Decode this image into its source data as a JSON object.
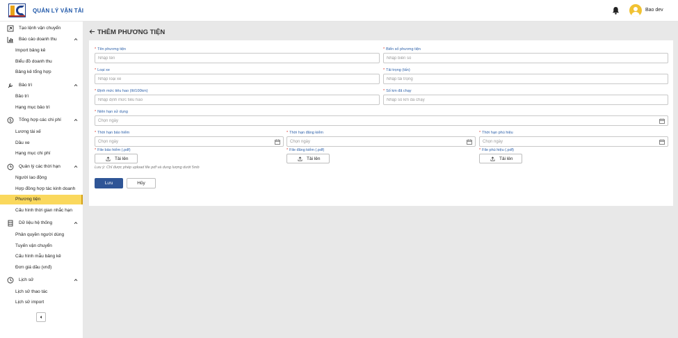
{
  "app": {
    "title": "QUẢN LÝ VẬN TẢI",
    "username": "Bao dev"
  },
  "icons": {
    "logo": "company-logo",
    "bell": "bell-icon",
    "avatar": "user-avatar-icon"
  },
  "colors": {
    "primary": "#2f5596",
    "active_menu": "#fad85d",
    "label_blue": "#2b5fa8",
    "required": "#d93025"
  },
  "sidebar": [
    {
      "type": "parent",
      "label": "Tạo lệnh vận chuyển",
      "icon": "external-link-icon"
    },
    {
      "type": "parent",
      "label": "Báo cáo doanh thu",
      "icon": "bar-chart-icon",
      "expanded": true
    },
    {
      "type": "child",
      "label": "Import bảng kê"
    },
    {
      "type": "child",
      "label": "Biểu đồ doanh thu"
    },
    {
      "type": "child",
      "label": "Bảng kê tổng hợp"
    },
    {
      "type": "parent",
      "label": "Bảo trì",
      "icon": "wrench-icon",
      "expanded": true
    },
    {
      "type": "child",
      "label": "Bảo trì"
    },
    {
      "type": "child",
      "label": "Hạng mục bảo trì"
    },
    {
      "type": "parent",
      "label": "Tổng hợp các chi phí",
      "icon": "dollar-icon",
      "expanded": true
    },
    {
      "type": "child",
      "label": "Lương tài xế"
    },
    {
      "type": "child",
      "label": "Dầu xe"
    },
    {
      "type": "child",
      "label": "Hạng mục chi phí"
    },
    {
      "type": "parent",
      "label": "Quản lý các thời hạn",
      "icon": "clock-icon",
      "expanded": true
    },
    {
      "type": "child",
      "label": "Người lao động"
    },
    {
      "type": "child",
      "label": "Hợp đồng hợp tác kinh doanh"
    },
    {
      "type": "child",
      "label": "Phương tiện",
      "active": true
    },
    {
      "type": "child",
      "label": "Cấu hình thời gian nhắc hạn"
    },
    {
      "type": "parent",
      "label": "Dữ liệu hệ thống",
      "icon": "database-icon",
      "expanded": true
    },
    {
      "type": "child",
      "label": "Phân quyền người dùng"
    },
    {
      "type": "child",
      "label": "Tuyến vận chuyển"
    },
    {
      "type": "child",
      "label": "Cấu hình mẫu bảng kê"
    },
    {
      "type": "child",
      "label": "Đơn giá dầu (vnđ)"
    },
    {
      "type": "parent",
      "label": "Lịch sử",
      "icon": "history-icon",
      "expanded": true
    },
    {
      "type": "child",
      "label": "Lịch sử thao tác"
    },
    {
      "type": "child",
      "label": "Lịch sử import"
    }
  ],
  "page": {
    "title": "THÊM PHƯƠNG TIỆN"
  },
  "form": {
    "required_mark": "*",
    "vehicle_name": {
      "label": "Tên phương tiện",
      "placeholder": "Nhập tên",
      "value": ""
    },
    "plate": {
      "label": "Biển số phương tiện",
      "placeholder": "Nhập biển số",
      "value": ""
    },
    "vehicle_type": {
      "label": "Loại xe",
      "placeholder": "Nhập loại xe",
      "value": ""
    },
    "load": {
      "label": "Tải trọng (tấn)",
      "placeholder": "Nhập tải trọng",
      "value": ""
    },
    "fuel_norm": {
      "label": "Định mức tiêu hao (lít/100km)",
      "placeholder": "Nhập định mức tiêu hao",
      "value": ""
    },
    "km_driven": {
      "label": "Số km đã chạy",
      "placeholder": "Nhập số km đã chạy",
      "value": ""
    },
    "service_life": {
      "label": "Niên hạn sử dụng",
      "placeholder": "Chọn ngày"
    },
    "insurance_date": {
      "label": "Thời hạn bảo hiểm",
      "placeholder": "Chọn ngày"
    },
    "registration_date": {
      "label": "Thời hạn đăng kiểm",
      "placeholder": "Chọn ngày"
    },
    "badge_date": {
      "label": "Thời hạn phù hiệu",
      "placeholder": "Chọn ngày"
    },
    "insurance_file": {
      "label": "File bảo hiểm (.pdf)",
      "button": "Tải lên"
    },
    "registration_file": {
      "label": "File đăng kiểm (.pdf)",
      "button": "Tải lên"
    },
    "badge_file": {
      "label": "File phù hiệu (.pdf)",
      "button": "Tải lên"
    },
    "note": "Lưu ý: Chỉ được phép upload file pdf và dung lượng dưới 5mb",
    "save": "Lưu",
    "cancel": "Hủy"
  }
}
